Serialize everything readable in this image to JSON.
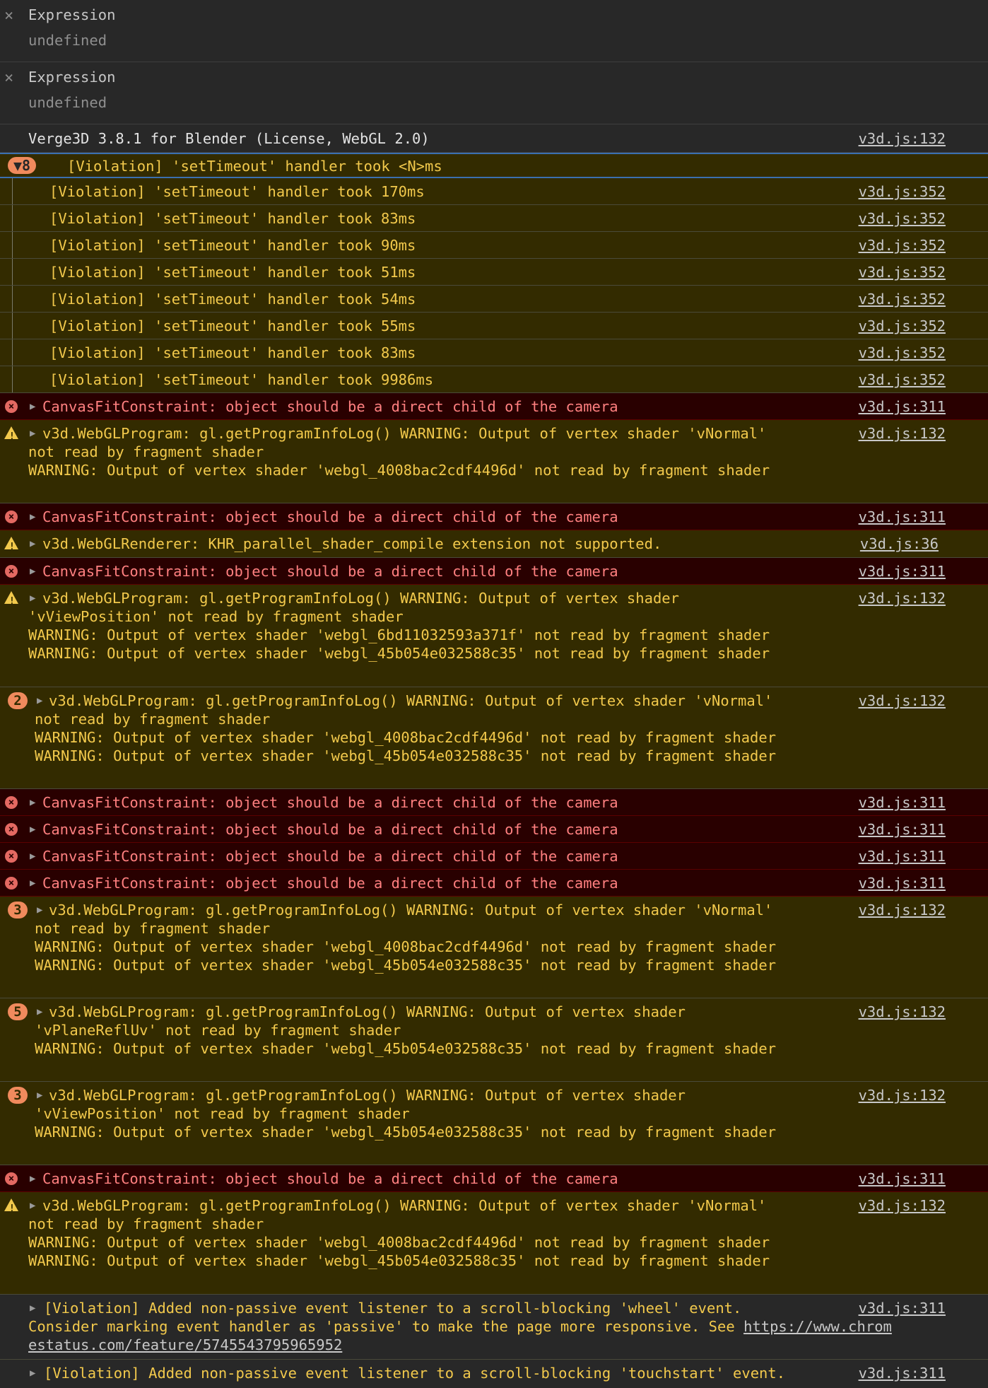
{
  "watch": [
    {
      "name": "Expression",
      "value": "undefined"
    },
    {
      "name": "Expression",
      "value": "undefined"
    }
  ],
  "info": {
    "message": "Verge3D 3.8.1 for Blender (License, WebGL 2.0)",
    "source": "v3d.js:132"
  },
  "group": {
    "count": "8",
    "title": "[Violation] 'setTimeout' handler took <N>ms",
    "items": [
      {
        "text": "[Violation] 'setTimeout' handler took 170ms",
        "source": "v3d.js:352"
      },
      {
        "text": "[Violation] 'setTimeout' handler took 83ms",
        "source": "v3d.js:352"
      },
      {
        "text": "[Violation] 'setTimeout' handler took 90ms",
        "source": "v3d.js:352"
      },
      {
        "text": "[Violation] 'setTimeout' handler took 51ms",
        "source": "v3d.js:352"
      },
      {
        "text": "[Violation] 'setTimeout' handler took 54ms",
        "source": "v3d.js:352"
      },
      {
        "text": "[Violation] 'setTimeout' handler took 55ms",
        "source": "v3d.js:352"
      },
      {
        "text": "[Violation] 'setTimeout' handler took 83ms",
        "source": "v3d.js:352"
      },
      {
        "text": "[Violation] 'setTimeout' handler took 9986ms",
        "source": "v3d.js:352"
      }
    ]
  },
  "canvas_error": "CanvasFitConstraint: object should be a direct child of the camera",
  "src311": "v3d.js:311",
  "src132": "v3d.js:132",
  "src36": "v3d.js:36",
  "w1": {
    "l1": "v3d.WebGLProgram: gl.getProgramInfoLog() WARNING: Output of vertex shader 'vNormal'",
    "l2": "not read by fragment shader",
    "l3": "WARNING: Output of vertex shader 'webgl_4008bac2cdf4496d' not read by fragment shader"
  },
  "w2": "v3d.WebGLRenderer: KHR_parallel_shader_compile extension not supported.",
  "w3": {
    "l1": "v3d.WebGLProgram: gl.getProgramInfoLog() WARNING: Output of vertex shader",
    "l2": "'vViewPosition' not read by fragment shader",
    "l3": "WARNING: Output of vertex shader 'webgl_6bd11032593a371f' not read by fragment shader",
    "l4": "WARNING: Output of vertex shader 'webgl_45b054e032588c35' not read by fragment shader"
  },
  "w4": {
    "count": "2",
    "l1": "v3d.WebGLProgram: gl.getProgramInfoLog() WARNING: Output of vertex shader 'vNormal'",
    "l2": "not read by fragment shader",
    "l3": "WARNING: Output of vertex shader 'webgl_4008bac2cdf4496d' not read by fragment shader",
    "l4": "WARNING: Output of vertex shader 'webgl_45b054e032588c35' not read by fragment shader"
  },
  "w5": {
    "count": "3",
    "l1": "v3d.WebGLProgram: gl.getProgramInfoLog() WARNING: Output of vertex shader 'vNormal'",
    "l2": "not read by fragment shader",
    "l3": "WARNING: Output of vertex shader 'webgl_4008bac2cdf4496d' not read by fragment shader",
    "l4": "WARNING: Output of vertex shader 'webgl_45b054e032588c35' not read by fragment shader"
  },
  "w6": {
    "count": "5",
    "l1": "v3d.WebGLProgram: gl.getProgramInfoLog() WARNING: Output of vertex shader",
    "l2": "'vPlaneReflUv' not read by fragment shader",
    "l3": "WARNING: Output of vertex shader 'webgl_45b054e032588c35' not read by fragment shader"
  },
  "w7": {
    "count": "3",
    "l1": "v3d.WebGLProgram: gl.getProgramInfoLog() WARNING: Output of vertex shader",
    "l2": "'vViewPosition' not read by fragment shader",
    "l3": "WARNING: Output of vertex shader 'webgl_45b054e032588c35' not read by fragment shader"
  },
  "w8": {
    "l1": "v3d.WebGLProgram: gl.getProgramInfoLog() WARNING: Output of vertex shader 'vNormal'",
    "l2": "not read by fragment shader",
    "l3": "WARNING: Output of vertex shader 'webgl_4008bac2cdf4496d' not read by fragment shader",
    "l4": "WARNING: Output of vertex shader 'webgl_45b054e032588c35' not read by fragment shader"
  },
  "v1": {
    "l1": "[Violation] Added non-passive event listener to a scroll-blocking 'wheel' event.",
    "l2": "Consider marking event handler as 'passive' to make the page more responsive. See ",
    "url1": "https://www.chrom",
    "url2": "estatus.com/feature/5745543795965952"
  },
  "v2": {
    "l1": "[Violation] Added non-passive event listener to a scroll-blocking 'touchstart' event."
  }
}
